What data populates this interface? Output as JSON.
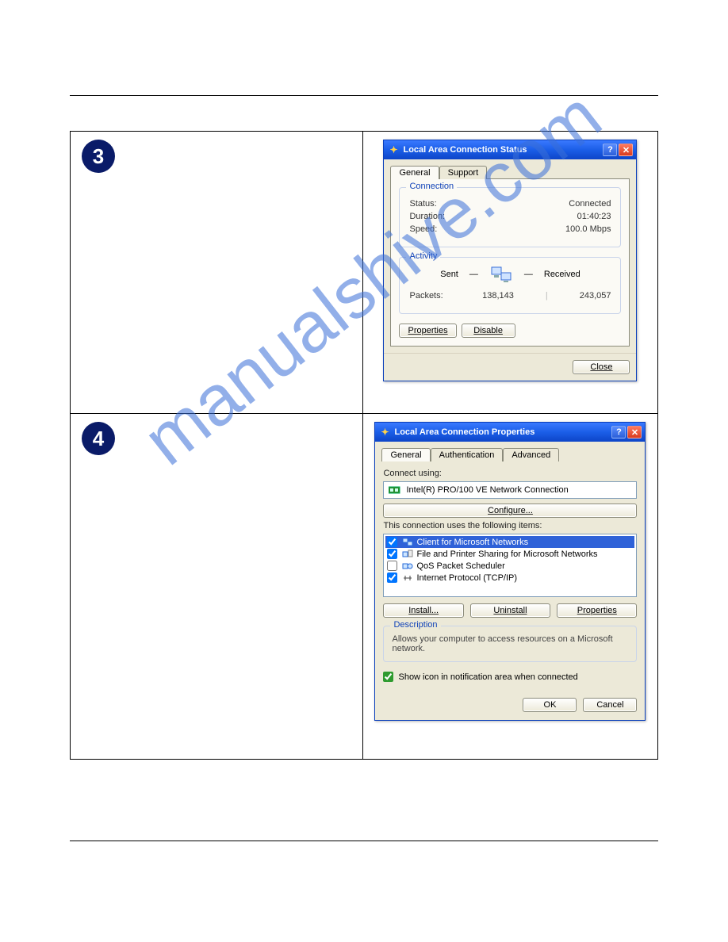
{
  "watermark": "manualshive.com",
  "steps": {
    "three": "3",
    "four": "4"
  },
  "status_dialog": {
    "title": "Local Area Connection Status",
    "tabs": {
      "general": "General",
      "support": "Support"
    },
    "connection": {
      "legend": "Connection",
      "status_label": "Status:",
      "status_value": "Connected",
      "duration_label": "Duration:",
      "duration_value": "01:40:23",
      "speed_label": "Speed:",
      "speed_value": "100.0 Mbps"
    },
    "activity": {
      "legend": "Activity",
      "sent": "Sent",
      "received": "Received",
      "packets_label": "Packets:",
      "sent_value": "138,143",
      "received_value": "243,057"
    },
    "buttons": {
      "properties": "Properties",
      "disable": "Disable",
      "close": "Close"
    }
  },
  "props_dialog": {
    "title": "Local Area Connection Properties",
    "tabs": {
      "general": "General",
      "auth": "Authentication",
      "advanced": "Advanced"
    },
    "connect_using_label": "Connect using:",
    "nic": "Intel(R) PRO/100 VE Network Connection",
    "configure": "Configure...",
    "items_label": "This connection uses the following items:",
    "items": [
      {
        "checked": true,
        "label": "Client for Microsoft Networks"
      },
      {
        "checked": true,
        "label": "File and Printer Sharing for Microsoft Networks"
      },
      {
        "checked": false,
        "label": "QoS Packet Scheduler"
      },
      {
        "checked": true,
        "label": "Internet Protocol (TCP/IP)"
      }
    ],
    "buttons": {
      "install": "Install...",
      "uninstall": "Uninstall",
      "properties": "Properties"
    },
    "description": {
      "legend": "Description",
      "text": "Allows your computer to access resources on a Microsoft network."
    },
    "show_icon": "Show icon in notification area when connected",
    "ok": "OK",
    "cancel": "Cancel"
  }
}
